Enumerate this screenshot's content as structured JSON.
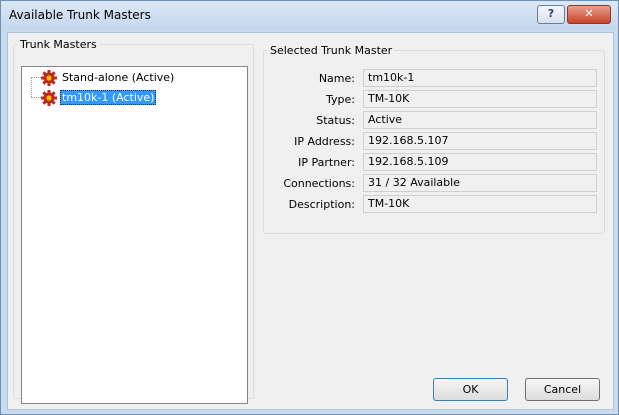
{
  "window": {
    "title": "Available Trunk Masters",
    "help_label": "?",
    "close_label": "✕"
  },
  "trunk_masters": {
    "legend": "Trunk Masters",
    "items": [
      {
        "label": "Stand-alone (Active)",
        "icon": "gear-icon",
        "selected": false
      },
      {
        "label": "tm10k-1 (Active)",
        "icon": "gear-icon",
        "selected": true
      }
    ]
  },
  "selected": {
    "legend": "Selected Trunk Master",
    "fields": [
      {
        "label": "Name:",
        "value": "tm10k-1"
      },
      {
        "label": "Type:",
        "value": "TM-10K"
      },
      {
        "label": "Status:",
        "value": "Active"
      },
      {
        "label": "IP Address:",
        "value": "192.168.5.107"
      },
      {
        "label": "IP Partner:",
        "value": "192.168.5.109"
      },
      {
        "label": "Connections:",
        "value": "31 / 32 Available"
      },
      {
        "label": "Description:",
        "value": "TM-10K"
      }
    ]
  },
  "buttons": {
    "ok": "OK",
    "cancel": "Cancel"
  },
  "colors": {
    "selection": "#3399ff",
    "gear_red": "#c0281c",
    "gear_yellow": "#f2c200"
  }
}
